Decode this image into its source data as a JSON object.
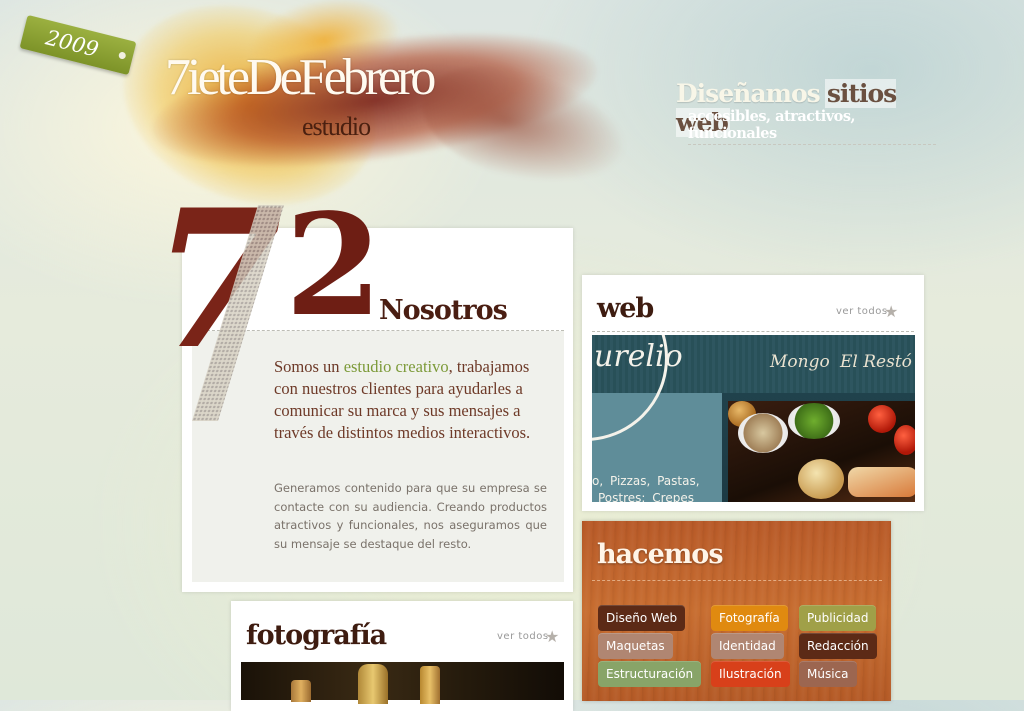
{
  "header": {
    "year_tag": "2009",
    "logo_title": "7ieteDeFebrero",
    "logo_subtitle": "estudio",
    "tagline_part1": "Diseñamos",
    "tagline_part2": "sitios web",
    "tagline_sub": "accesibles, atractivos, funcionales"
  },
  "nosotros": {
    "numeral_left": "7",
    "numeral_right": "2",
    "title": "Nosotros",
    "lead_before": "Somos un ",
    "lead_highlight": "estudio creativo",
    "lead_after": ", trabajamos con nuestros clientes para ayudarles a comunicar su marca y sus mensajes a través de distintos medios interactivos.",
    "body": "Generamos contenido para que su empresa se contacte con su audiencia. Creando productos atractivos y funcionales, nos aseguramos que su mensaje se destaque del resto."
  },
  "fotografia": {
    "title": "fotografía",
    "see_all": "ver todos"
  },
  "web": {
    "title": "web",
    "see_all": "ver todos",
    "screenshot": {
      "logo_script": "urelio",
      "nav_items": [
        "Mongo",
        "El Restó"
      ],
      "menu_line1": "o, Pizzas, Pastas,",
      "menu_line2": "Postres; Crepes"
    }
  },
  "hacemos": {
    "title": "hacemos",
    "services": [
      {
        "label": "Diseño Web",
        "color": "#5c2a16"
      },
      {
        "label": "Fotografía",
        "color": "#e08a10"
      },
      {
        "label": "Publicidad",
        "color": "#a0a048"
      },
      {
        "label": "Maquetas",
        "color": "#b08672"
      },
      {
        "label": "Identidad",
        "color": "#b08672"
      },
      {
        "label": "Redacción",
        "color": "#5c2a16"
      },
      {
        "label": "Estructuración",
        "color": "#88a468"
      },
      {
        "label": "Ilustración",
        "color": "#d8401a"
      },
      {
        "label": "Música",
        "color": "#9c6650"
      }
    ]
  },
  "icons": {
    "star": "star-icon"
  }
}
